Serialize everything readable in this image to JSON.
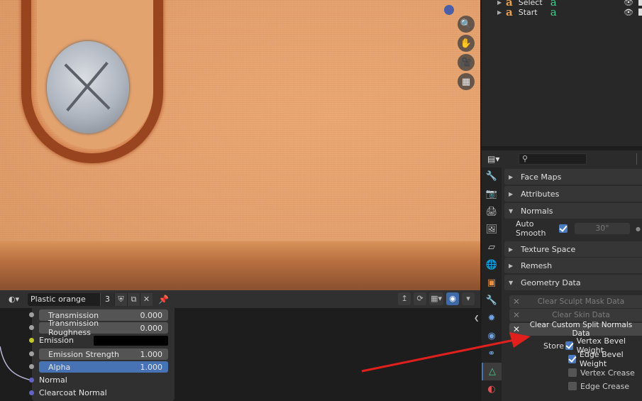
{
  "outliner": {
    "rows": [
      {
        "label": "Select",
        "mat": "a"
      },
      {
        "label": "Start",
        "mat": "a"
      }
    ]
  },
  "properties": {
    "search_placeholder": "",
    "tabs": [
      "tool-icon",
      "render-icon",
      "output-icon",
      "view-layer-icon",
      "scene-icon",
      "world-icon",
      "object-icon",
      "modifier-icon",
      "particles-icon",
      "physics-icon",
      "constraints-icon",
      "data-icon",
      "material-icon"
    ],
    "panels": {
      "face_maps": "Face Maps",
      "attributes": "Attributes",
      "normals": "Normals",
      "auto_smooth_label": "Auto Smooth",
      "auto_smooth_angle": "30°",
      "texture_space": "Texture Space",
      "remesh": "Remesh",
      "geometry_data": "Geometry Data",
      "clear_sculpt_mask": "Clear Sculpt Mask Data",
      "clear_skin": "Clear Skin Data",
      "clear_custom_normals": "Clear Custom Split Normals Data",
      "store_label": "Store",
      "store_options": [
        {
          "label": "Vertex Bevel Weight",
          "checked": true
        },
        {
          "label": "Edge Bevel Weight",
          "checked": true
        },
        {
          "label": "Vertex Crease",
          "checked": false
        },
        {
          "label": "Edge Crease",
          "checked": false
        }
      ]
    }
  },
  "node_editor": {
    "material_name": "Plastic orange",
    "users": "3",
    "node_rows": {
      "transmission": {
        "label": "Transmission",
        "value": "0.000"
      },
      "transmission_roughness": {
        "label": "Transmission Roughness",
        "value": "0.000"
      },
      "emission": "Emission",
      "emission_strength": {
        "label": "Emission Strength",
        "value": "1.000"
      },
      "alpha": {
        "label": "Alpha",
        "value": "1.000"
      },
      "normal": "Normal",
      "clearcoat_normal": "Clearcoat Normal"
    }
  },
  "colors": {
    "accent": "#4772b3",
    "annotation_arrow": "#e0201c"
  }
}
